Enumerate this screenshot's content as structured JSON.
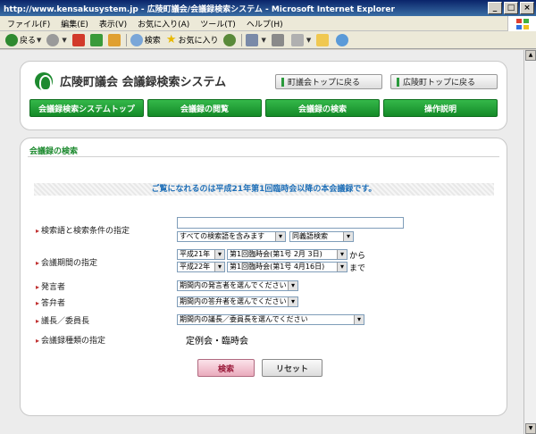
{
  "window": {
    "title": "http://www.kensakusystem.jp - 広陵町議会/会議録検索システム - Microsoft Internet Explorer",
    "controls": [
      "_",
      "□",
      "×"
    ]
  },
  "menu": [
    "ファイル(F)",
    "編集(E)",
    "表示(V)",
    "お気に入り(A)",
    "ツール(T)",
    "ヘルプ(H)"
  ],
  "toolbar": {
    "back": "戻る",
    "search": "検索",
    "favorites": "お気に入り"
  },
  "header": {
    "site_title": "広陵町議会 会議録検索システム",
    "link_council_top": "町議会トップに戻る",
    "link_town_top": "広陵町トップに戻る",
    "nav": [
      "会議録検索システムトップ",
      "会議録の閲覧",
      "会議録の検索",
      "操作説明"
    ]
  },
  "search": {
    "section_title": "会議録の検索",
    "notice": "ご覧になれるのは平成21年第1回臨時会以降の本会議録です。",
    "keyword": {
      "label": "検索語と検索条件の指定",
      "value": "",
      "condition": "すべての検索語を含みます",
      "mode": "同義語検索"
    },
    "period": {
      "label": "会議期間の指定",
      "from_year": "平成21年",
      "from_session": "第1回臨時会(第1号 2月 3日)",
      "from_suffix": "から",
      "to_year": "平成22年",
      "to_session": "第1回臨時会(第1号 4月16日)",
      "to_suffix": "まで"
    },
    "speaker": {
      "label": "発言者",
      "value": "期間内の発言者を選んでください"
    },
    "responder": {
      "label": "答弁者",
      "value": "期間内の答弁者を選んでください"
    },
    "chair": {
      "label": "議長／委員長",
      "value": "期間内の議長／委員長を選んでください"
    },
    "type": {
      "label": "会議録種類の指定",
      "value": "定例会・臨時会"
    },
    "submit": "検索",
    "reset": "リセット"
  }
}
